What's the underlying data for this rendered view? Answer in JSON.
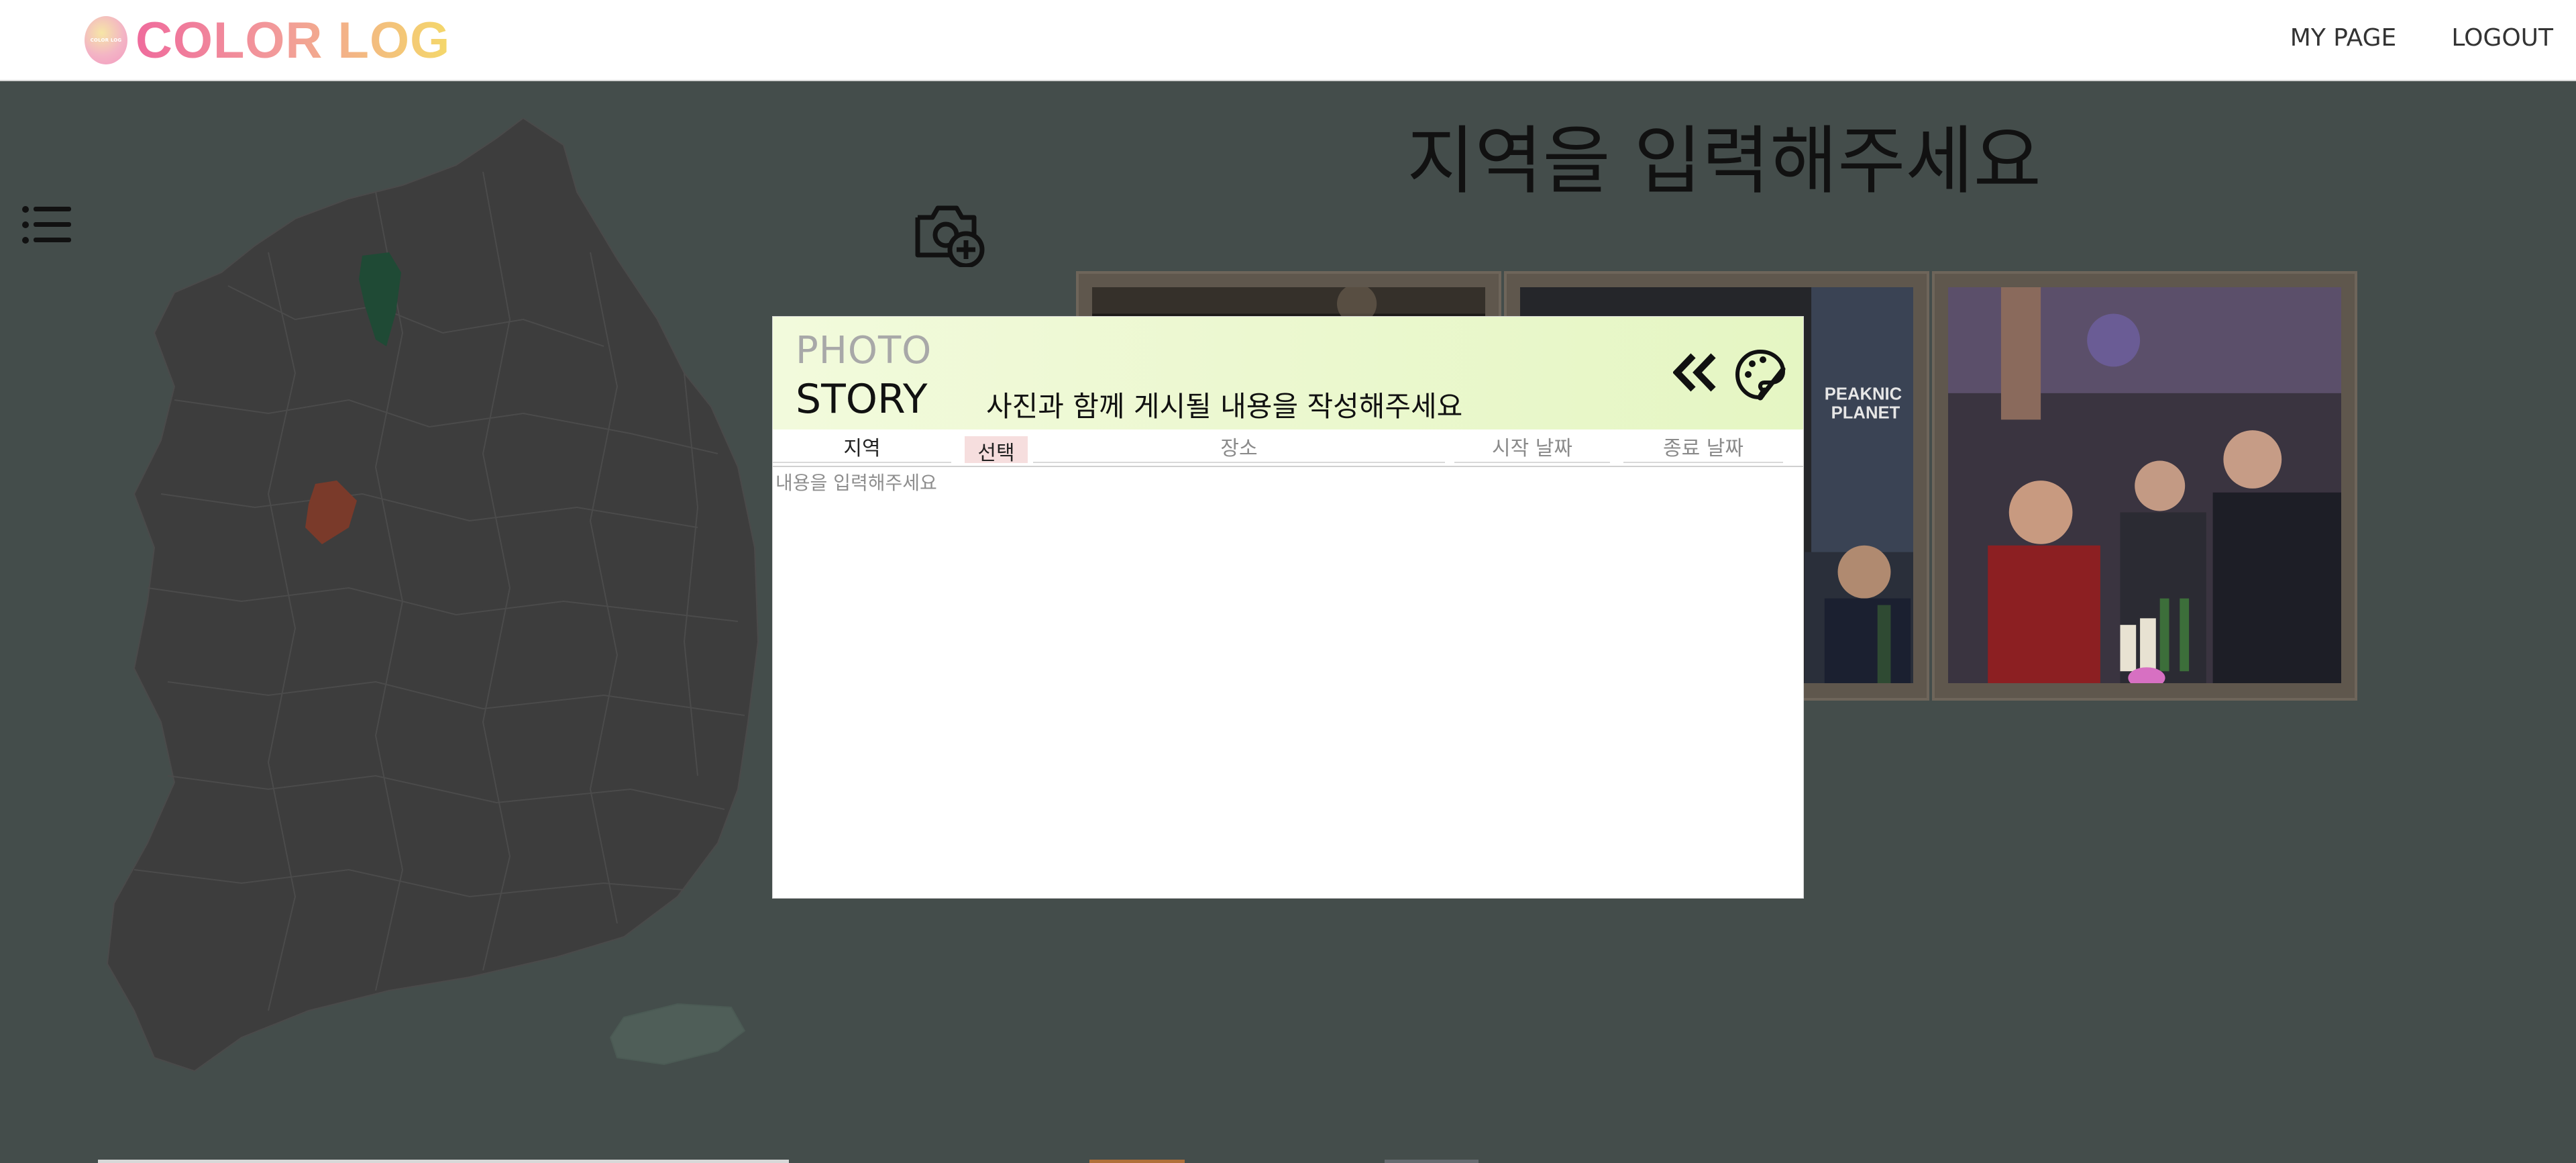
{
  "header": {
    "logo_small": "COLOR LOG",
    "logo_text": "COLOR LOG",
    "nav": {
      "my_page": "MY PAGE",
      "logout": "LOGOUT"
    }
  },
  "main": {
    "title": "지역을 입력해주세요",
    "map_highlight_colors": {
      "region_a": "#1f4a35",
      "region_b": "#7a3a2a",
      "region_c": "#4f5e58"
    }
  },
  "modal": {
    "label_photo": "PHOTO",
    "label_story": "STORY",
    "hint": "사진과 함께 게시될 내용을 작성해주세요",
    "fields": {
      "region_label": "지역",
      "select_button": "선택",
      "place_placeholder": "장소",
      "start_date_placeholder": "시작 날짜",
      "end_date_placeholder": "종료 날짜"
    },
    "content_placeholder": "내용을 입력해주세요"
  },
  "photo_card_c": {
    "sign_line_1": "PEAKNIC",
    "sign_line_2": "PLANET"
  },
  "colors": {
    "background_overlay": "#444d4b",
    "modal_header": "#e8f7cc",
    "select_button": "#f6dede"
  }
}
